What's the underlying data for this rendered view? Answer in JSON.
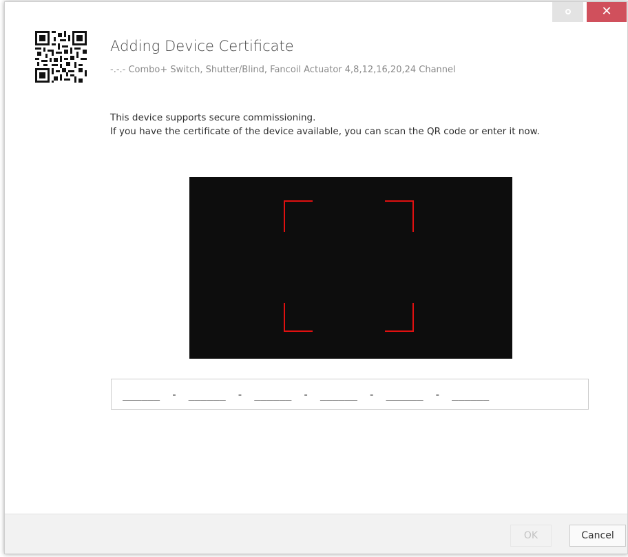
{
  "dialog": {
    "title": "Adding Device Certificate",
    "subtitle": "-.-.- Combo+ Switch, Shutter/Blind, Fancoil Actuator 4,8,12,16,20,24 Channel",
    "description_line1": "This device supports secure commissioning.",
    "description_line2": "If you have the certificate of the device available, you can scan the QR code or enter it now.",
    "logo_icon": "qr-code-icon"
  },
  "window_controls": {
    "settings_icon": "gear-icon",
    "close_label": "✕"
  },
  "camera": {
    "frame_color": "#e01010",
    "background": "#0d0d0d"
  },
  "certificate_input": {
    "segments": [
      "______",
      "______",
      "______",
      "______",
      "______",
      "______"
    ],
    "separator": "-"
  },
  "footer": {
    "ok_label": "OK",
    "cancel_label": "Cancel"
  },
  "colors": {
    "close_button": "#d0505c",
    "settings_button": "#e3e3e3"
  }
}
